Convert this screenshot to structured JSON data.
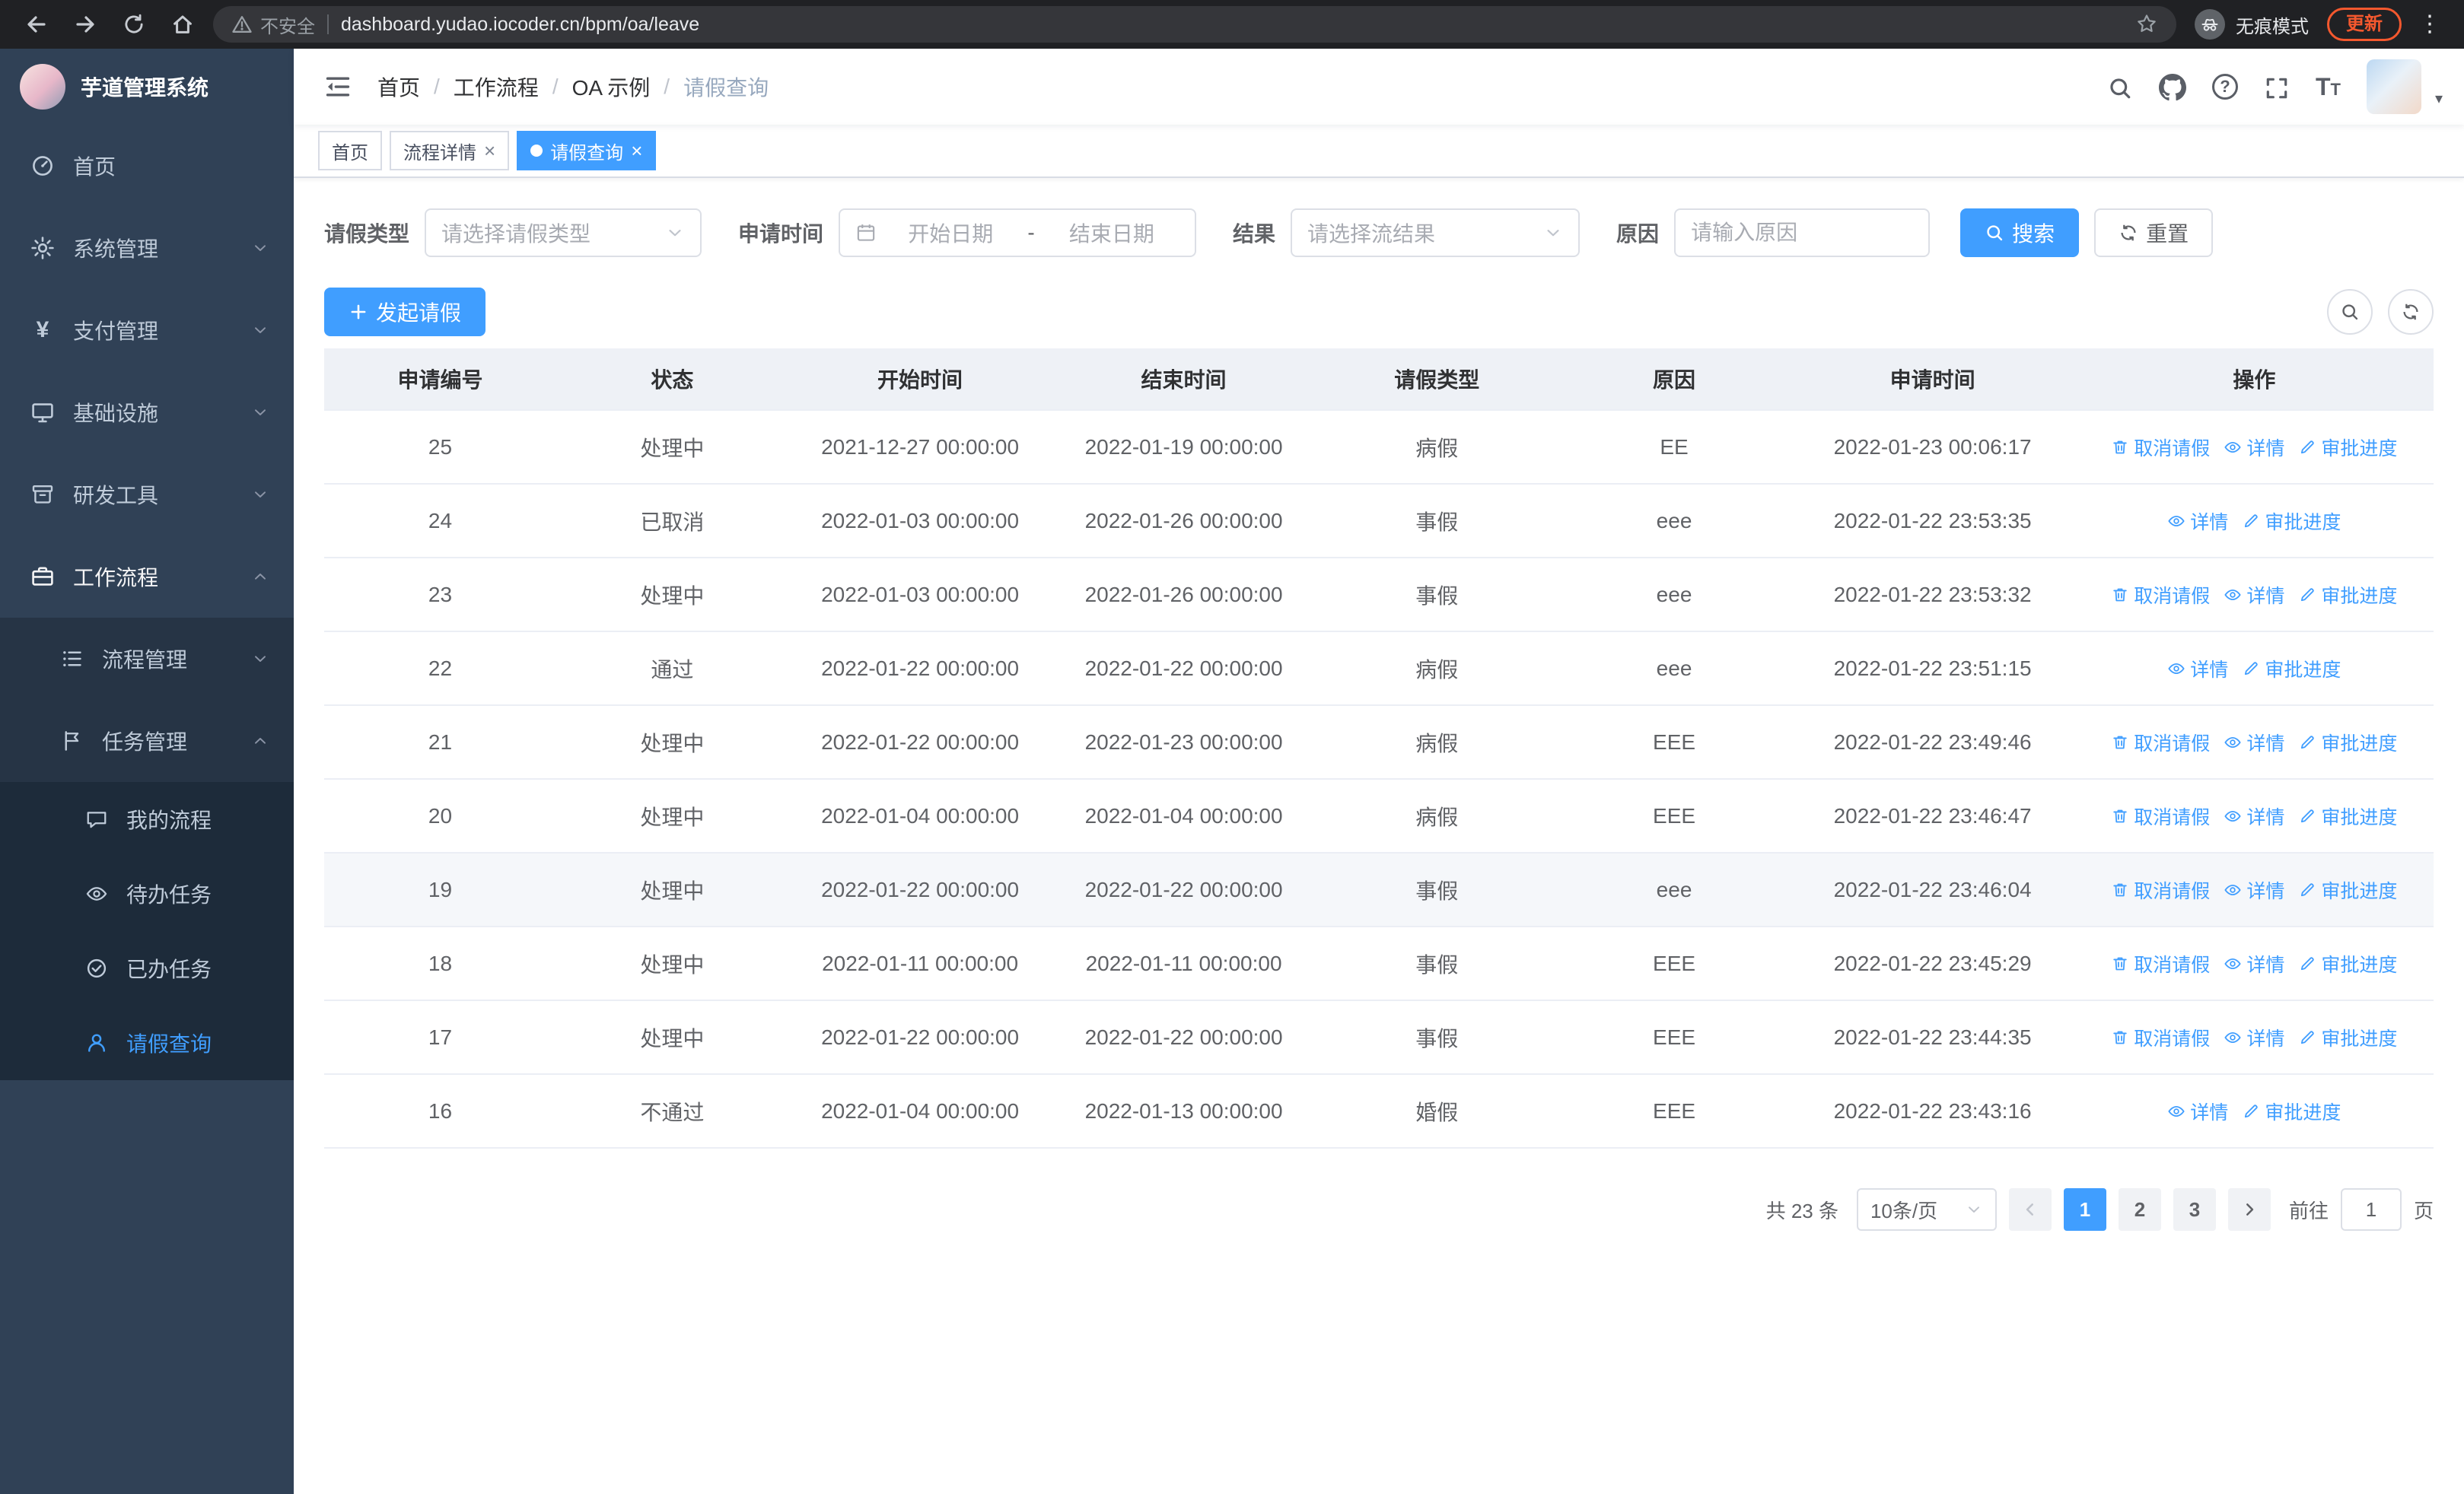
{
  "theme": {
    "primary": "#409eff",
    "sidebar_bg": "#304156",
    "submenu_bg": "#263445",
    "submenu_deep_bg": "#1d2b3a",
    "chrome_bg": "#202124",
    "omnibox_bg": "#35363a",
    "update_accent": "#f4582e",
    "table_header_bg": "#eef1f6"
  },
  "browser": {
    "security_label": "不安全",
    "url": "dashboard.yudao.iocoder.cn/bpm/oa/leave",
    "incognito_label": "无痕模式",
    "update_label": "更新"
  },
  "icons": {
    "close": "×",
    "menu_dots": "⋮",
    "caret_down": "▾",
    "yen": "¥",
    "question": "?",
    "font_large": "T",
    "font_small": "T"
  },
  "sidebar": {
    "logo_title": "芋道管理系统",
    "items": [
      {
        "label": "首页"
      },
      {
        "label": "系统管理"
      },
      {
        "label": "支付管理"
      },
      {
        "label": "基础设施"
      },
      {
        "label": "研发工具"
      },
      {
        "label": "工作流程"
      }
    ],
    "level2": [
      {
        "label": "流程管理"
      },
      {
        "label": "任务管理"
      }
    ],
    "level3": [
      {
        "label": "我的流程"
      },
      {
        "label": "待办任务"
      },
      {
        "label": "已办任务"
      },
      {
        "label": "请假查询"
      }
    ]
  },
  "breadcrumb": {
    "separator": "/",
    "items": [
      "首页",
      "工作流程",
      "OA 示例",
      "请假查询"
    ]
  },
  "tabs": [
    {
      "label": "首页"
    },
    {
      "label": "流程详情"
    },
    {
      "label": "请假查询"
    }
  ],
  "filters": {
    "leave_type_label": "请假类型",
    "leave_type_placeholder": "请选择请假类型",
    "apply_time_label": "申请时间",
    "start_date_placeholder": "开始日期",
    "range_separator": "-",
    "end_date_placeholder": "结束日期",
    "result_label": "结果",
    "result_placeholder": "请选择流结果",
    "reason_label": "原因",
    "reason_placeholder": "请输入原因",
    "search_button": "搜索",
    "reset_button": "重置"
  },
  "toolbar": {
    "create_button": "发起请假"
  },
  "table": {
    "columns": [
      "申请编号",
      "状态",
      "开始时间",
      "结束时间",
      "请假类型",
      "原因",
      "申请时间",
      "操作"
    ],
    "op_labels": {
      "cancel": "取消请假",
      "detail": "详情",
      "progress": "审批进度"
    },
    "rows": [
      {
        "id": "25",
        "status": "处理中",
        "start": "2021-12-27 00:00:00",
        "end": "2022-01-19 00:00:00",
        "type": "病假",
        "reason": "EE",
        "applyTime": "2022-01-23 00:06:17"
      },
      {
        "id": "24",
        "status": "已取消",
        "start": "2022-01-03 00:00:00",
        "end": "2022-01-26 00:00:00",
        "type": "事假",
        "reason": "eee",
        "applyTime": "2022-01-22 23:53:35"
      },
      {
        "id": "23",
        "status": "处理中",
        "start": "2022-01-03 00:00:00",
        "end": "2022-01-26 00:00:00",
        "type": "事假",
        "reason": "eee",
        "applyTime": "2022-01-22 23:53:32"
      },
      {
        "id": "22",
        "status": "通过",
        "start": "2022-01-22 00:00:00",
        "end": "2022-01-22 00:00:00",
        "type": "病假",
        "reason": "eee",
        "applyTime": "2022-01-22 23:51:15"
      },
      {
        "id": "21",
        "status": "处理中",
        "start": "2022-01-22 00:00:00",
        "end": "2022-01-23 00:00:00",
        "type": "病假",
        "reason": "EEE",
        "applyTime": "2022-01-22 23:49:46"
      },
      {
        "id": "20",
        "status": "处理中",
        "start": "2022-01-04 00:00:00",
        "end": "2022-01-04 00:00:00",
        "type": "病假",
        "reason": "EEE",
        "applyTime": "2022-01-22 23:46:47"
      },
      {
        "id": "19",
        "status": "处理中",
        "start": "2022-01-22 00:00:00",
        "end": "2022-01-22 00:00:00",
        "type": "事假",
        "reason": "eee",
        "applyTime": "2022-01-22 23:46:04"
      },
      {
        "id": "18",
        "status": "处理中",
        "start": "2022-01-11 00:00:00",
        "end": "2022-01-11 00:00:00",
        "type": "事假",
        "reason": "EEE",
        "applyTime": "2022-01-22 23:45:29"
      },
      {
        "id": "17",
        "status": "处理中",
        "start": "2022-01-22 00:00:00",
        "end": "2022-01-22 00:00:00",
        "type": "事假",
        "reason": "EEE",
        "applyTime": "2022-01-22 23:44:35"
      },
      {
        "id": "16",
        "status": "不通过",
        "start": "2022-01-04 00:00:00",
        "end": "2022-01-13 00:00:00",
        "type": "婚假",
        "reason": "EEE",
        "applyTime": "2022-01-22 23:43:16"
      }
    ]
  },
  "pagination": {
    "total": "共 23 条",
    "page_size": "10条/页",
    "pages": [
      "1",
      "2",
      "3"
    ],
    "goto_label": "前往",
    "goto_value": "1",
    "unit_label": "页"
  }
}
